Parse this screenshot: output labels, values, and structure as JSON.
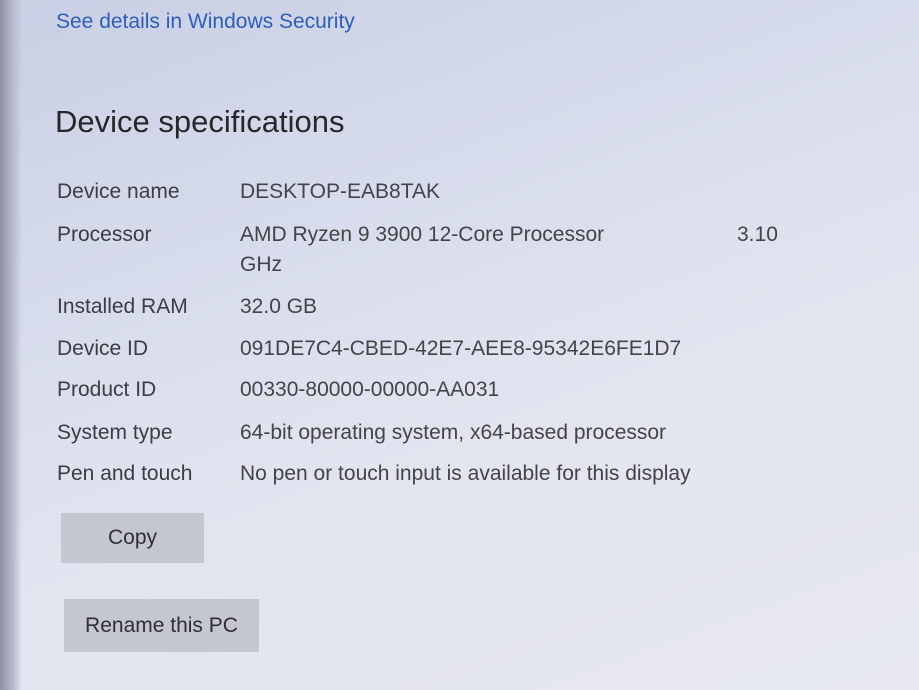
{
  "security_link": "See details in Windows Security",
  "section_title": "Device specifications",
  "specs": {
    "device_name": {
      "label": "Device name",
      "value": "DESKTOP-EAB8TAK"
    },
    "processor": {
      "label": "Processor",
      "value": "AMD Ryzen 9 3900 12-Core Processor",
      "speed": "3.10",
      "unit": "GHz"
    },
    "installed_ram": {
      "label": "Installed RAM",
      "value": "32.0 GB"
    },
    "device_id": {
      "label": "Device ID",
      "value": "091DE7C4-CBED-42E7-AEE8-95342E6FE1D7"
    },
    "product_id": {
      "label": "Product ID",
      "value": "00330-80000-00000-AA031"
    },
    "system_type": {
      "label": "System type",
      "value": "64-bit operating system, x64-based processor"
    },
    "pen_and_touch": {
      "label": "Pen and touch",
      "value": "No pen or touch input is available for this display"
    }
  },
  "buttons": {
    "copy": "Copy",
    "rename": "Rename this PC"
  },
  "colors": {
    "link": "#2f5db8",
    "button_bg": "#c4c6d0",
    "background": "#dfe2ee"
  }
}
